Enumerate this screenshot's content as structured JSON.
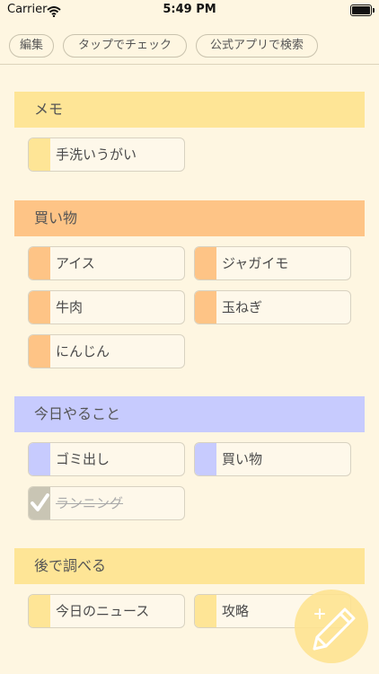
{
  "status_bar": {
    "carrier": "Carrier",
    "time": "5:49 PM"
  },
  "toolbar": {
    "edit_label": "編集",
    "tap_check_label": "タップでチェック",
    "search_label": "公式アプリで検索"
  },
  "colors": {
    "memo": "#FEE596",
    "shopping": "#FEC486",
    "today": "#C7CBFE",
    "later": "#FEE596",
    "checked": "#C9C5B4",
    "background": "#FEF6E1"
  },
  "sections": [
    {
      "title": "メモ",
      "items": [
        {
          "label": "手洗いうがい",
          "checked": false
        }
      ]
    },
    {
      "title": "買い物",
      "items": [
        {
          "label": "アイス",
          "checked": false
        },
        {
          "label": "ジャガイモ",
          "checked": false
        },
        {
          "label": "牛肉",
          "checked": false
        },
        {
          "label": "玉ねぎ",
          "checked": false
        },
        {
          "label": "にんじん",
          "checked": false
        }
      ]
    },
    {
      "title": "今日やること",
      "items": [
        {
          "label": "ゴミ出し",
          "checked": false
        },
        {
          "label": "買い物",
          "checked": false
        },
        {
          "label": "ランニング",
          "checked": true
        }
      ]
    },
    {
      "title": "後で調べる",
      "items": [
        {
          "label": "今日のニュース",
          "checked": false
        },
        {
          "label": "攻略",
          "checked": false
        }
      ]
    }
  ],
  "fab": {
    "icon": "pencil-icon"
  }
}
